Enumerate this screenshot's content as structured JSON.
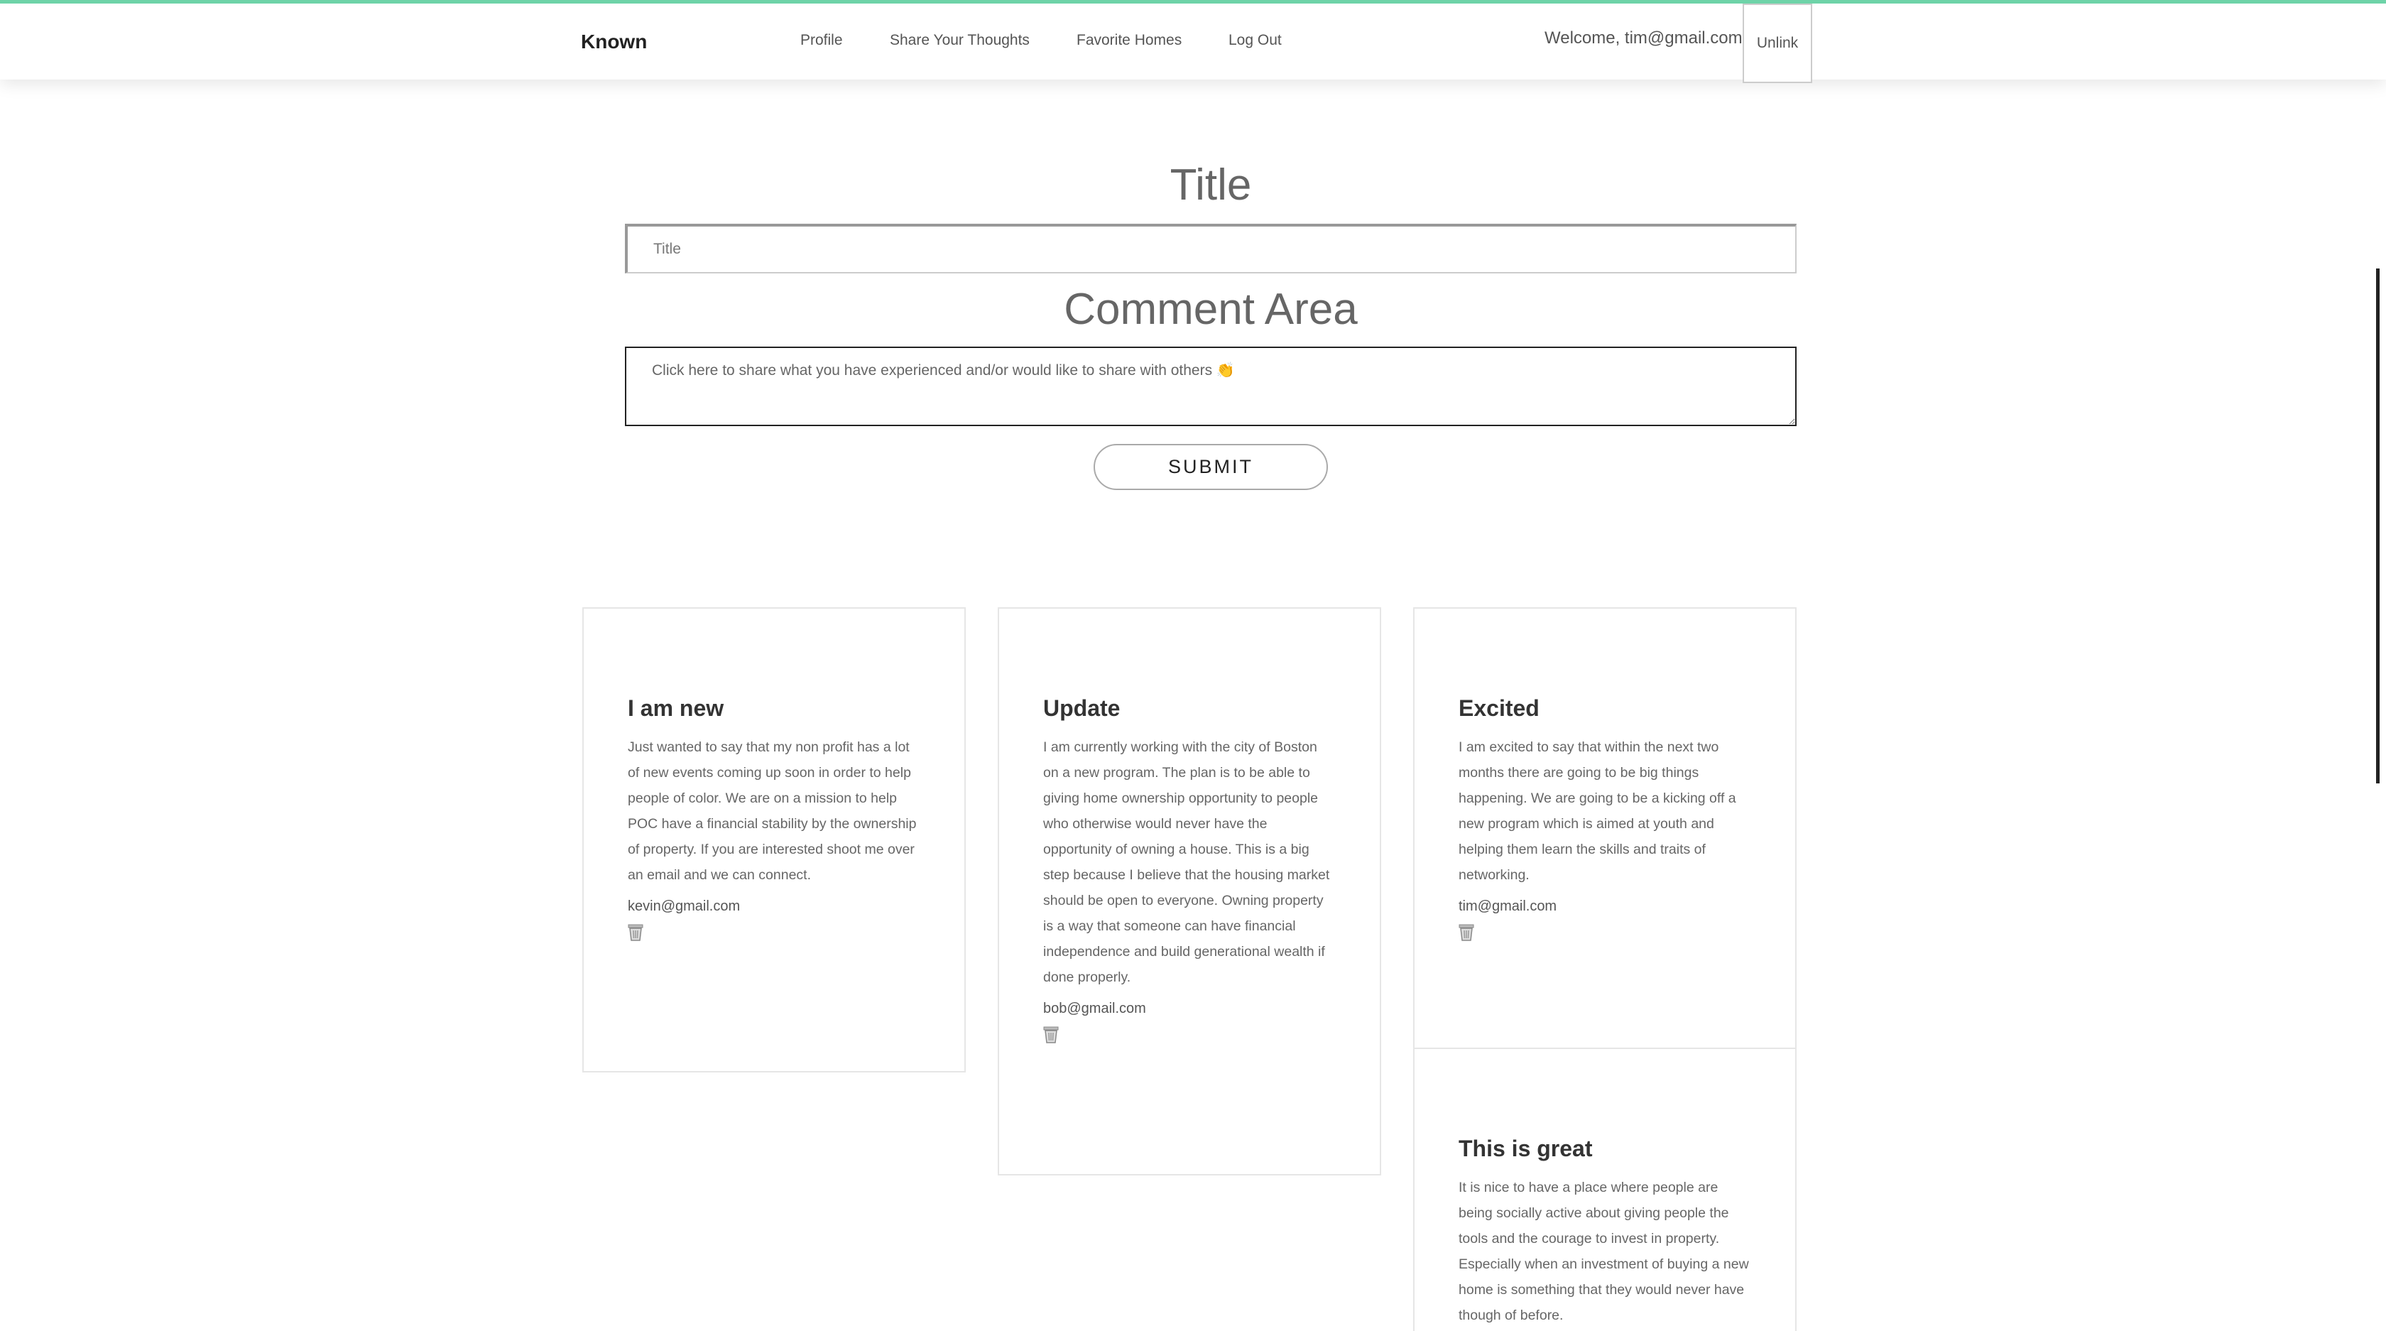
{
  "header": {
    "brand": "Known",
    "nav": [
      "Profile",
      "Share Your Thoughts",
      "Favorite Homes",
      "Log Out"
    ],
    "welcome": "Welcome, tim@gmail.com",
    "unlink": "Unlink"
  },
  "form": {
    "title_heading": "Title",
    "title_placeholder": "Title",
    "comment_heading": "Comment Area",
    "comment_placeholder": "Click here to share what you have experienced and/or would like to share with others 👏",
    "submit_label": "SUBMIT"
  },
  "posts": [
    {
      "title": "I am new",
      "body": "Just wanted to say that my non profit has a lot of new events coming up soon in order to help people of color. We are on a mission to help POC have a financial stability by the ownership of property. If you are interested shoot me over an email and we can connect.",
      "email": "kevin@gmail.com"
    },
    {
      "title": "Update",
      "body": "I am currently working with the city of Boston on a new program. The plan is to be able to giving home ownership opportunity to people who otherwise would never have the opportunity of owning a house. This is a big step because I believe that the housing market should be open to everyone. Owning property is a way that someone can have financial independence and build generational wealth if done properly.",
      "email": "bob@gmail.com"
    },
    {
      "title": "Excited",
      "body": "I am excited to say that within the next two months there are going to be big things happening. We are going to be a kicking off a new program which is aimed at youth and helping them learn the skills and traits of networking.",
      "email": "tim@gmail.com"
    },
    {
      "title": "This is great",
      "body": "It is nice to have a place where people are being socially active about giving people the tools and the courage to invest in property. Especially when an investment of buying a new home is something that they would never have though of before.",
      "email": ""
    }
  ],
  "icons": {
    "delete": "trash-icon"
  },
  "colors": {
    "accent_top_border": "#6ed3a8",
    "text": "#333333"
  }
}
